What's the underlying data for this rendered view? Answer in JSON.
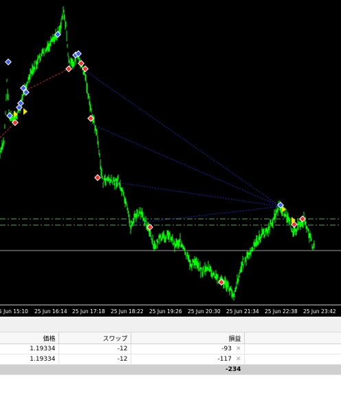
{
  "chart": {
    "background_color": "#000000",
    "candle_color": "#00ff00",
    "time_axis_labels": [
      "5 Jun 15:10",
      "25 Jun 16:14",
      "25 Jun 17:18",
      "25 Jun 18:22",
      "25 Jun 19:26",
      "25 Jun 20:30",
      "25 Jun 21:34",
      "25 Jun 22:38",
      "25 Jun 23:42"
    ],
    "buy_marker_color": "#3a5cff",
    "sell_marker_color": "#ff2a2a",
    "history_line_color": "#2020c8",
    "level_line_color": "#46b446"
  },
  "trade_table": {
    "columns": {
      "price": "価格",
      "swap": "スワップ",
      "profit": "損益"
    },
    "rows": [
      {
        "price": "1.19334",
        "swap": "-12",
        "profit": "-93"
      },
      {
        "price": "1.19334",
        "swap": "-12",
        "profit": "-117"
      }
    ],
    "total": {
      "profit": "-234"
    },
    "close_icon": "close-x-icon"
  }
}
